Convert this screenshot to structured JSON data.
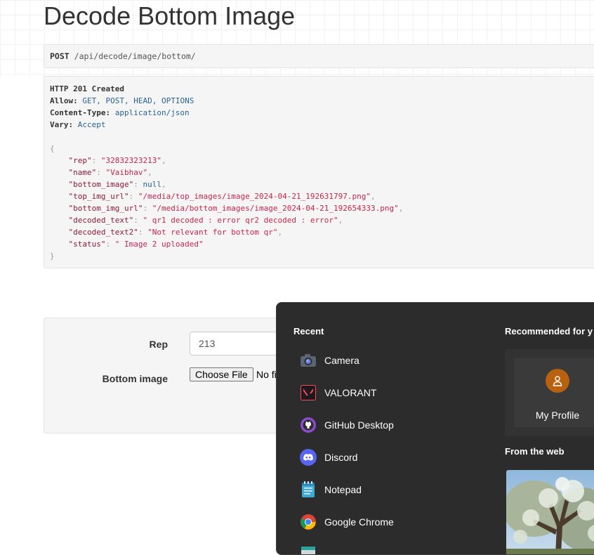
{
  "page": {
    "title": "Decode Bottom Image"
  },
  "request": {
    "method": "POST",
    "path": "/api/decode/image/bottom/"
  },
  "response": {
    "status_line": "HTTP 201 Created",
    "headers": [
      {
        "key": "Allow:",
        "value": "GET, POST, HEAD, OPTIONS"
      },
      {
        "key": "Content-Type:",
        "value": "application/json"
      },
      {
        "key": "Vary:",
        "value": "Accept"
      }
    ],
    "open_brace": "{",
    "close_brace": "}",
    "body": [
      {
        "key": "\"rep\"",
        "value": "\"32832323213\"",
        "comma": ","
      },
      {
        "key": "\"name\"",
        "value": "\"Vaibhav\"",
        "comma": ","
      },
      {
        "key": "\"bottom_image\"",
        "value": "null",
        "comma": ","
      },
      {
        "key": "\"top_img_url\"",
        "value": "\"/media/top_images/image_2024-04-21_192631797.png\"",
        "comma": ","
      },
      {
        "key": "\"bottom_img_url\"",
        "value": "\"/media/bottom_images/image_2024-04-21_192654333.png\"",
        "comma": ","
      },
      {
        "key": "\"decoded_text\"",
        "value": "\" qr1 decoded : error qr2 decoded : error\"",
        "comma": ","
      },
      {
        "key": "\"decoded_text2\"",
        "value": "\"Not relevant for bottom qr\"",
        "comma": ","
      },
      {
        "key": "\"status\"",
        "value": "\" Image 2 uploaded\"",
        "comma": ""
      }
    ]
  },
  "form": {
    "rep_label": "Rep",
    "rep_value": "213",
    "bottom_image_label": "Bottom image",
    "choose_file_label": "Choose File",
    "file_status": "No fi"
  },
  "start_menu": {
    "recent_title": "Recent",
    "recommended_title": "Recommended for y",
    "from_web_title": "From the web",
    "profile_label": "My Profile",
    "apps": [
      {
        "label": "Camera",
        "icon": "camera-icon"
      },
      {
        "label": "VALORANT",
        "icon": "valorant-icon"
      },
      {
        "label": "GitHub Desktop",
        "icon": "github-icon"
      },
      {
        "label": "Discord",
        "icon": "discord-icon"
      },
      {
        "label": "Notepad",
        "icon": "notepad-icon"
      },
      {
        "label": "Google Chrome",
        "icon": "chrome-icon"
      }
    ]
  },
  "colors": {
    "start_menu_bg": "#2c2c2c",
    "avatar": "#b8620f",
    "json_string": "#c7254e",
    "header_value": "#2a6496"
  }
}
